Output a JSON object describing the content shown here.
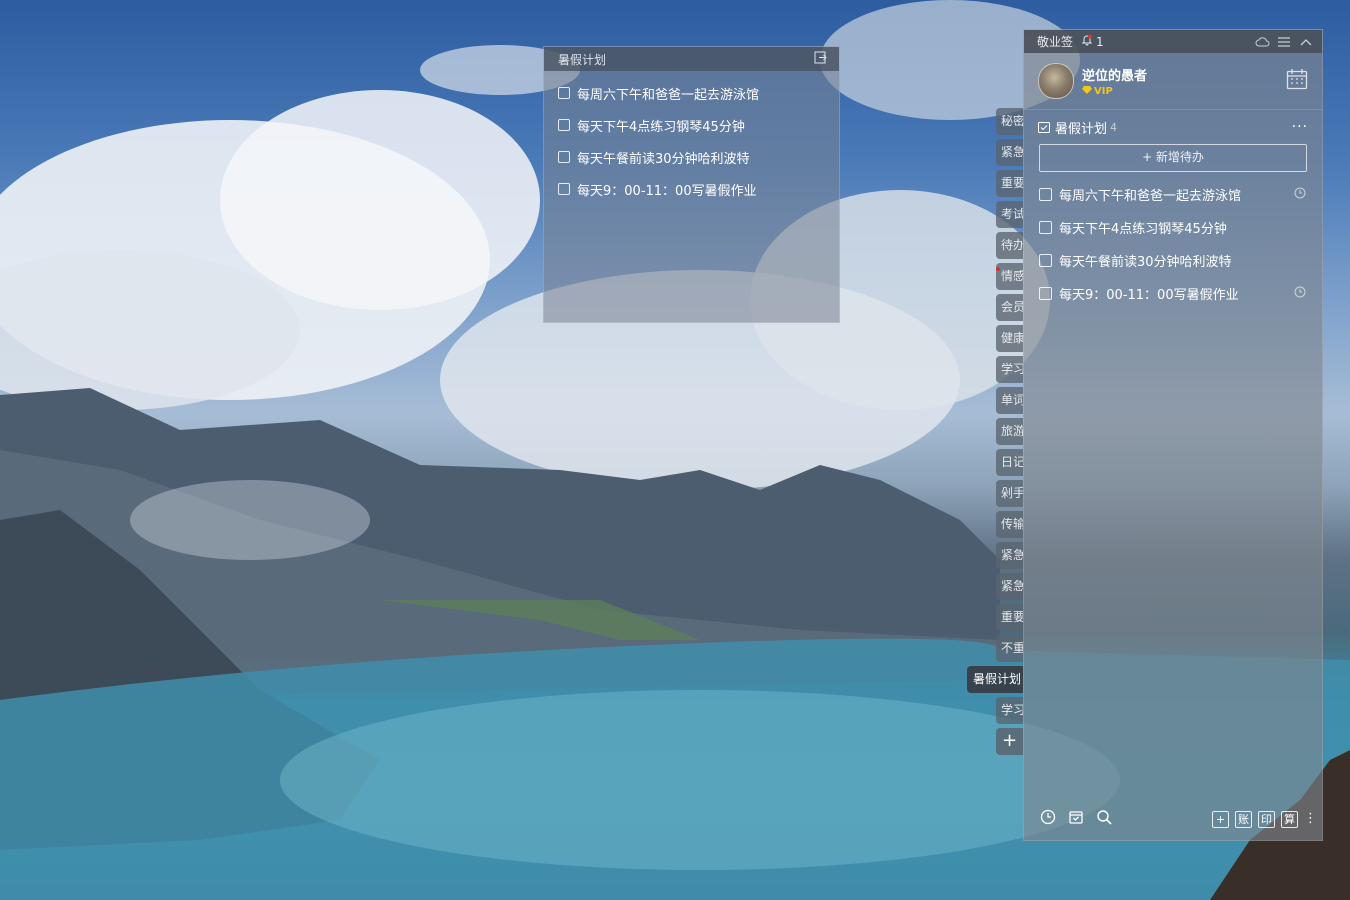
{
  "note": {
    "title": "暑假计划",
    "items": [
      "每周六下午和爸爸一起去游泳馆",
      "每天下午4点练习钢琴45分钟",
      "每天午餐前读30分钟哈利波特",
      "每天9：00-11：00写暑假作业"
    ]
  },
  "tabs": [
    "秘密",
    "紧急",
    "重要",
    "考试",
    "待办",
    "情感",
    "会员",
    "健康",
    "学习",
    "单词",
    "旅游",
    "日记",
    "剁手",
    "传输",
    "紧急",
    "紧急",
    "重要",
    "不重",
    "暑假计划",
    "学习"
  ],
  "tabs_active_index": 18,
  "panel": {
    "app_name": "敬业签",
    "notification_count": "1",
    "user": {
      "name": "逆位的愚者",
      "badge": "VIP"
    },
    "list": {
      "title": "暑假计划",
      "count": "4",
      "more": "···",
      "add_label": "+ 新增待办",
      "todos": [
        {
          "text": "每周六下午和爸爸一起去游泳馆",
          "has_reminder": true
        },
        {
          "text": "每天下午4点练习钢琴45分钟",
          "has_reminder": false
        },
        {
          "text": "每天午餐前读30分钟哈利波特",
          "has_reminder": false
        },
        {
          "text": "每天9：00-11：00写暑假作业",
          "has_reminder": true
        }
      ]
    },
    "toolbar": {
      "add": "+",
      "ledger": "账",
      "print": "印",
      "calc": "算"
    }
  },
  "colors": {
    "vip": "#f5c518",
    "badge_red": "#e0302f"
  }
}
